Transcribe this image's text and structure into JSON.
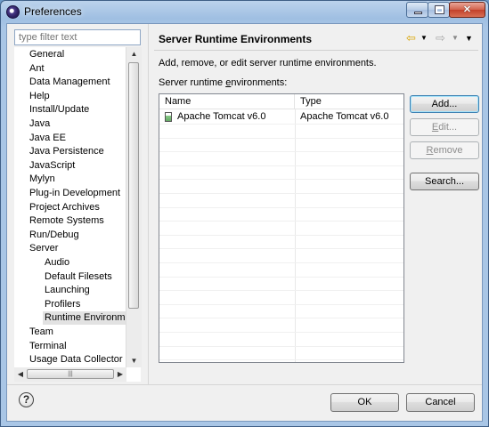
{
  "window": {
    "title": "Preferences"
  },
  "filter": {
    "placeholder": "type filter text"
  },
  "tree": {
    "items": [
      {
        "label": "General",
        "indent": 0
      },
      {
        "label": "Ant",
        "indent": 0
      },
      {
        "label": "Data Management",
        "indent": 0
      },
      {
        "label": "Help",
        "indent": 0
      },
      {
        "label": "Install/Update",
        "indent": 0
      },
      {
        "label": "Java",
        "indent": 0
      },
      {
        "label": "Java EE",
        "indent": 0
      },
      {
        "label": "Java Persistence",
        "indent": 0
      },
      {
        "label": "JavaScript",
        "indent": 0
      },
      {
        "label": "Mylyn",
        "indent": 0
      },
      {
        "label": "Plug-in Development",
        "indent": 0
      },
      {
        "label": "Project Archives",
        "indent": 0
      },
      {
        "label": "Remote Systems",
        "indent": 0
      },
      {
        "label": "Run/Debug",
        "indent": 0
      },
      {
        "label": "Server",
        "indent": 0
      },
      {
        "label": "Audio",
        "indent": 1
      },
      {
        "label": "Default Filesets",
        "indent": 1
      },
      {
        "label": "Launching",
        "indent": 1
      },
      {
        "label": "Profilers",
        "indent": 1
      },
      {
        "label": "Runtime Environme",
        "indent": 1,
        "selected": true
      },
      {
        "label": "Team",
        "indent": 0
      },
      {
        "label": "Terminal",
        "indent": 0
      },
      {
        "label": "Usage Data Collector",
        "indent": 0
      }
    ]
  },
  "page": {
    "title": "Server Runtime Environments",
    "description": "Add, remove, or edit server runtime environments.",
    "table_label_pre": "Server runtime ",
    "table_label_mnemonic": "e",
    "table_label_post": "nvironments:"
  },
  "table": {
    "columns": [
      "Name",
      "Type"
    ],
    "rows": [
      {
        "name": "Apache Tomcat v6.0",
        "type": "Apache Tomcat v6.0"
      }
    ]
  },
  "buttons": {
    "add": "Add...",
    "edit_mnemonic": "E",
    "edit_rest": "dit...",
    "remove_mnemonic": "R",
    "remove_rest": "emove",
    "search": "Search...",
    "ok": "OK",
    "cancel": "Cancel"
  }
}
